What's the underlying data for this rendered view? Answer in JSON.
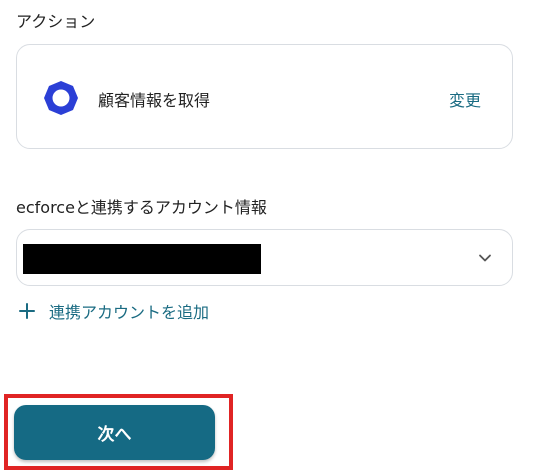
{
  "action_section": {
    "heading": "アクション",
    "card": {
      "app_icon": "ecforce-ring-icon",
      "action_name": "顧客情報を取得",
      "change_label": "変更"
    }
  },
  "account_section": {
    "heading": "ecforceと連携するアカウント情報",
    "select": {
      "selected_value_masked": true,
      "chevron_icon": "chevron-down-icon"
    },
    "add_account": {
      "icon": "plus-icon",
      "label": "連携アカウントを追加"
    }
  },
  "footer": {
    "next_label": "次へ"
  },
  "colors": {
    "accent": "#156a84",
    "link": "#1a6b82",
    "app_icon": "#2b3fd6",
    "highlight": "#e02424",
    "border": "#d9dde2"
  }
}
